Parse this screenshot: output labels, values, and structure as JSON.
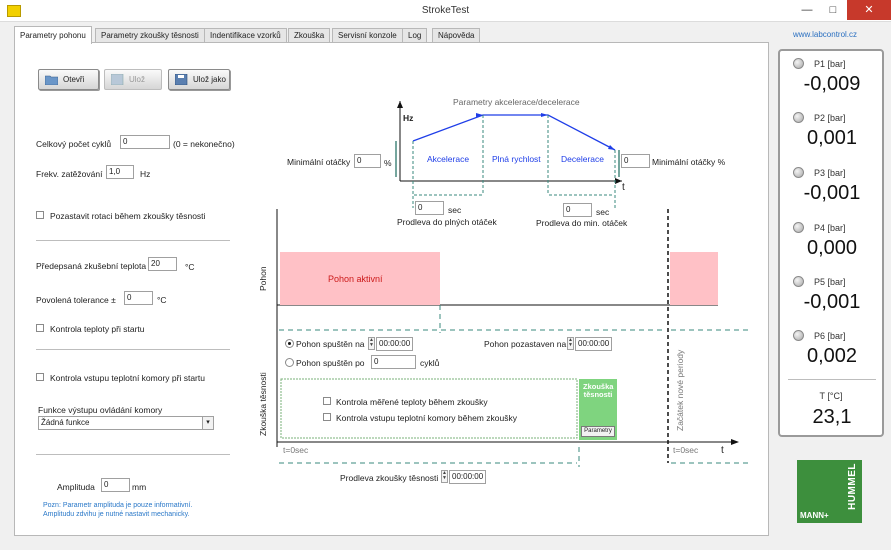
{
  "window": {
    "title": "StrokeTest",
    "minimize": "—",
    "maximize": "□",
    "close": "✕"
  },
  "tabs": [
    {
      "label": "Parametry pohonu"
    },
    {
      "label": "Parametry zkoušky těsnosti"
    },
    {
      "label": "Indentifikace vzorků"
    },
    {
      "label": "Zkouška"
    },
    {
      "label": "Servisní konzole"
    },
    {
      "label": "Log"
    },
    {
      "label": "Nápověda"
    }
  ],
  "toolbar": {
    "open": "Otevři",
    "save": "Ulož",
    "save_as": "Ulož jako"
  },
  "form": {
    "cycles_label": "Celkový počet cyklů",
    "cycles_value": "0",
    "cycles_hint": "(0 = nekonečno)",
    "freq_label": "Frekv. zatěžování",
    "freq_value": "1,0",
    "freq_unit": "Hz",
    "pause_label": "Pozastavit rotaci během zkoušky těsnosti",
    "temp_label": "Předepsaná zkušební teplota",
    "temp_value": "20",
    "temp_unit": "°C",
    "tol_label": "Povolená tolerance ±",
    "tol_value": "0",
    "tol_unit": "°C",
    "temp_check_label": "Kontrola teploty při startu",
    "inlet_check_label": "Kontrola vstupu teplotní komory při startu",
    "func_label": "Funkce výstupu ovládání komory",
    "func_value": "Žádná funkce",
    "amp_label": "Amplituda",
    "amp_value": "0",
    "amp_unit": "mm",
    "note_line1": "Pozn: Parametr amplituda je pouze informativní.",
    "note_line2": "Amplitudu zdvihu je nutné nastavit mechanicky."
  },
  "diagram": {
    "title": "Parametry akcelerace/decelerace",
    "y_label": "Hz",
    "t_label": "t",
    "min_label_left": "Minimální otáčky",
    "min_value_left": "0",
    "min_unit_left": "%",
    "min_value_right": "0",
    "min_label_right": "Minimální otáčky %",
    "seg_accel": "Akcelerace",
    "seg_full": "Plná rychlost",
    "seg_decel": "Decelerace",
    "delay1_value": "0",
    "delay1_unit": "sec",
    "delay1_label": "Prodleva do plných otáček",
    "delay2_value": "0",
    "delay2_unit": "sec",
    "delay2_label": "Prodleva do min. otáček",
    "drive_axis": "Pohon",
    "drive_active": "Pohon aktivní",
    "start_on_label": "Pohon spuštěn na",
    "start_on_value": "00:00:00",
    "stopped_label": "Pohon pozastaven na",
    "stopped_value": "00:00:00",
    "start_after_label": "Pohon spuštěn po",
    "start_after_value": "0",
    "start_after_unit": "cyklů",
    "leak_axis": "Zkouška těsnosti",
    "measured_temp_label": "Kontrola měřené teploty během zkoušky",
    "inlet_label": "Kontrola vstupu teplotní komory během zkoušky",
    "leak_box_label": "Zkouška těsnosti",
    "params_btn": "Parametry",
    "new_period": "Začátek nové periody",
    "t0_left": "t=0sec",
    "t0_right": "t=0sec",
    "leak_delay_label": "Prodleva zkoušky těsnosti",
    "leak_delay_value": "00:00:00"
  },
  "side": {
    "link": "www.labcontrol.cz",
    "gauges": [
      {
        "label": "P1 [bar]",
        "value": "-0,009"
      },
      {
        "label": "P2 [bar]",
        "value": "0,001"
      },
      {
        "label": "P3 [bar]",
        "value": "-0,001"
      },
      {
        "label": "P4 [bar]",
        "value": "0,000"
      },
      {
        "label": "P5 [bar]",
        "value": "-0,001"
      },
      {
        "label": "P6 [bar]",
        "value": "0,002"
      }
    ],
    "temp_label": "T [°C]",
    "temp_value": "23,1",
    "logo_word1": "MANN",
    "logo_plus": "+",
    "logo_word2": "HUMMEL"
  },
  "colors": {
    "accent_blue": "#1f3ee8",
    "teal": "#3a8a7e",
    "drive_fill": "#ffc1c6",
    "drive_text": "#cc1a1a",
    "leak_fill": "#7fd47f",
    "logo_green": "#3d8f3d"
  }
}
